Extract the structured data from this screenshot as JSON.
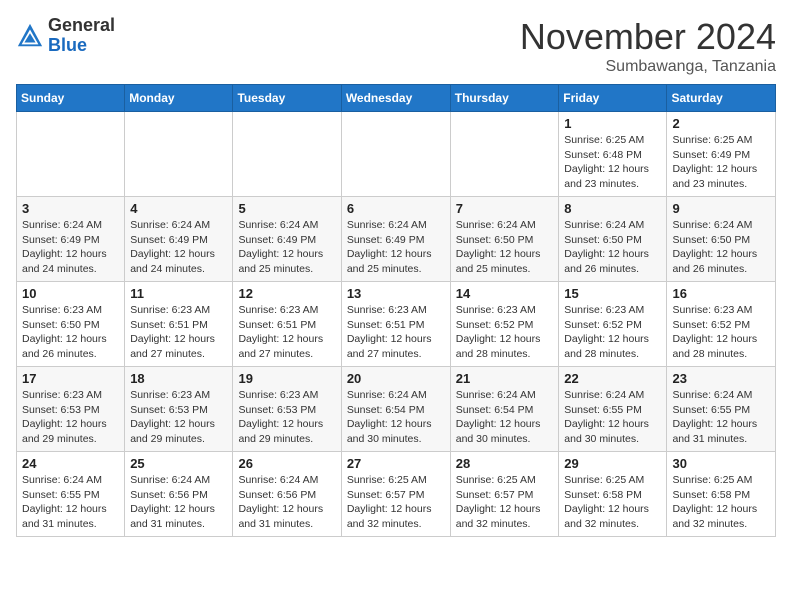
{
  "header": {
    "logo_general": "General",
    "logo_blue": "Blue",
    "month_title": "November 2024",
    "location": "Sumbawanga, Tanzania"
  },
  "weekdays": [
    "Sunday",
    "Monday",
    "Tuesday",
    "Wednesday",
    "Thursday",
    "Friday",
    "Saturday"
  ],
  "weeks": [
    [
      {
        "day": "",
        "info": ""
      },
      {
        "day": "",
        "info": ""
      },
      {
        "day": "",
        "info": ""
      },
      {
        "day": "",
        "info": ""
      },
      {
        "day": "",
        "info": ""
      },
      {
        "day": "1",
        "info": "Sunrise: 6:25 AM\nSunset: 6:48 PM\nDaylight: 12 hours and 23 minutes."
      },
      {
        "day": "2",
        "info": "Sunrise: 6:25 AM\nSunset: 6:49 PM\nDaylight: 12 hours and 23 minutes."
      }
    ],
    [
      {
        "day": "3",
        "info": "Sunrise: 6:24 AM\nSunset: 6:49 PM\nDaylight: 12 hours and 24 minutes."
      },
      {
        "day": "4",
        "info": "Sunrise: 6:24 AM\nSunset: 6:49 PM\nDaylight: 12 hours and 24 minutes."
      },
      {
        "day": "5",
        "info": "Sunrise: 6:24 AM\nSunset: 6:49 PM\nDaylight: 12 hours and 25 minutes."
      },
      {
        "day": "6",
        "info": "Sunrise: 6:24 AM\nSunset: 6:49 PM\nDaylight: 12 hours and 25 minutes."
      },
      {
        "day": "7",
        "info": "Sunrise: 6:24 AM\nSunset: 6:50 PM\nDaylight: 12 hours and 25 minutes."
      },
      {
        "day": "8",
        "info": "Sunrise: 6:24 AM\nSunset: 6:50 PM\nDaylight: 12 hours and 26 minutes."
      },
      {
        "day": "9",
        "info": "Sunrise: 6:24 AM\nSunset: 6:50 PM\nDaylight: 12 hours and 26 minutes."
      }
    ],
    [
      {
        "day": "10",
        "info": "Sunrise: 6:23 AM\nSunset: 6:50 PM\nDaylight: 12 hours and 26 minutes."
      },
      {
        "day": "11",
        "info": "Sunrise: 6:23 AM\nSunset: 6:51 PM\nDaylight: 12 hours and 27 minutes."
      },
      {
        "day": "12",
        "info": "Sunrise: 6:23 AM\nSunset: 6:51 PM\nDaylight: 12 hours and 27 minutes."
      },
      {
        "day": "13",
        "info": "Sunrise: 6:23 AM\nSunset: 6:51 PM\nDaylight: 12 hours and 27 minutes."
      },
      {
        "day": "14",
        "info": "Sunrise: 6:23 AM\nSunset: 6:52 PM\nDaylight: 12 hours and 28 minutes."
      },
      {
        "day": "15",
        "info": "Sunrise: 6:23 AM\nSunset: 6:52 PM\nDaylight: 12 hours and 28 minutes."
      },
      {
        "day": "16",
        "info": "Sunrise: 6:23 AM\nSunset: 6:52 PM\nDaylight: 12 hours and 28 minutes."
      }
    ],
    [
      {
        "day": "17",
        "info": "Sunrise: 6:23 AM\nSunset: 6:53 PM\nDaylight: 12 hours and 29 minutes."
      },
      {
        "day": "18",
        "info": "Sunrise: 6:23 AM\nSunset: 6:53 PM\nDaylight: 12 hours and 29 minutes."
      },
      {
        "day": "19",
        "info": "Sunrise: 6:23 AM\nSunset: 6:53 PM\nDaylight: 12 hours and 29 minutes."
      },
      {
        "day": "20",
        "info": "Sunrise: 6:24 AM\nSunset: 6:54 PM\nDaylight: 12 hours and 30 minutes."
      },
      {
        "day": "21",
        "info": "Sunrise: 6:24 AM\nSunset: 6:54 PM\nDaylight: 12 hours and 30 minutes."
      },
      {
        "day": "22",
        "info": "Sunrise: 6:24 AM\nSunset: 6:55 PM\nDaylight: 12 hours and 30 minutes."
      },
      {
        "day": "23",
        "info": "Sunrise: 6:24 AM\nSunset: 6:55 PM\nDaylight: 12 hours and 31 minutes."
      }
    ],
    [
      {
        "day": "24",
        "info": "Sunrise: 6:24 AM\nSunset: 6:55 PM\nDaylight: 12 hours and 31 minutes."
      },
      {
        "day": "25",
        "info": "Sunrise: 6:24 AM\nSunset: 6:56 PM\nDaylight: 12 hours and 31 minutes."
      },
      {
        "day": "26",
        "info": "Sunrise: 6:24 AM\nSunset: 6:56 PM\nDaylight: 12 hours and 31 minutes."
      },
      {
        "day": "27",
        "info": "Sunrise: 6:25 AM\nSunset: 6:57 PM\nDaylight: 12 hours and 32 minutes."
      },
      {
        "day": "28",
        "info": "Sunrise: 6:25 AM\nSunset: 6:57 PM\nDaylight: 12 hours and 32 minutes."
      },
      {
        "day": "29",
        "info": "Sunrise: 6:25 AM\nSunset: 6:58 PM\nDaylight: 12 hours and 32 minutes."
      },
      {
        "day": "30",
        "info": "Sunrise: 6:25 AM\nSunset: 6:58 PM\nDaylight: 12 hours and 32 minutes."
      }
    ]
  ]
}
